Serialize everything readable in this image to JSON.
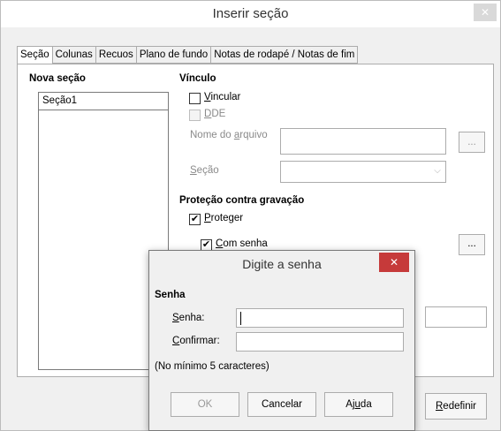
{
  "main_dialog": {
    "title": "Inserir seção",
    "close_glyph": "✕",
    "tabs": [
      "Seção",
      "Colunas",
      "Recuos",
      "Plano de fundo",
      "Notas de rodapé / Notas de fim"
    ],
    "new_section": {
      "heading": "Nova seção",
      "value": "Seção1"
    },
    "link": {
      "heading": "Vínculo",
      "link_label": "Vincular",
      "dde_label": "DDE",
      "filename_label": "Nome do arquivo",
      "browse_label": "...",
      "section_label": "Seção",
      "section_arrow": "⌵"
    },
    "protection": {
      "heading": "Proteção contra gravação",
      "protect_label": "Proteger",
      "protect_check": "✔",
      "with_password_label": "Com senha",
      "with_password_check": "✔",
      "password_button": "..."
    },
    "reset_button": "Redefinir"
  },
  "password_dialog": {
    "title": "Digite a senha",
    "close_glyph": "✕",
    "group_heading": "Senha",
    "password_label": "Senha:",
    "confirm_label": "Confirmar:",
    "hint": "(No mínimo 5 caracteres)",
    "ok_label": "OK",
    "cancel_label": "Cancelar",
    "help_label": "Ajuda"
  }
}
